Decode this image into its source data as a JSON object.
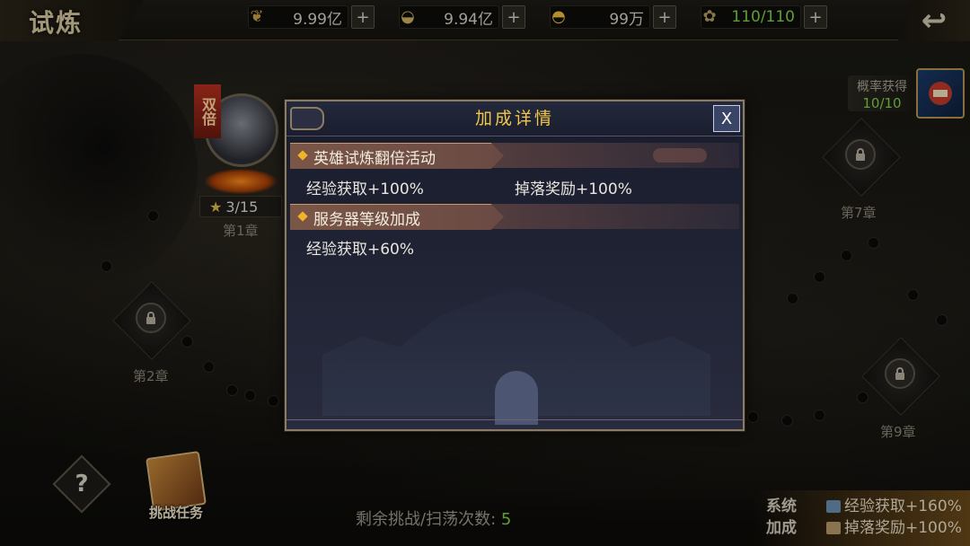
{
  "top": {
    "title": "试炼",
    "resources": [
      {
        "icon": "wheat-icon",
        "value": "9.99亿",
        "plus": "+"
      },
      {
        "icon": "silver-ingot-icon",
        "value": "9.94亿",
        "plus": "+"
      },
      {
        "icon": "gold-ingot-icon",
        "value": "99万",
        "plus": "+"
      },
      {
        "icon": "stamina-icon",
        "value": "110/110",
        "plus": "+"
      }
    ]
  },
  "map": {
    "chapter1": "第1章",
    "chapter2": "第2章",
    "chapter7": "第7章",
    "chapter9": "第9章",
    "hero_tag": "双倍",
    "stars": "3/15",
    "prob_label": "概率获得",
    "prob_count": "10/10"
  },
  "bottom": {
    "help": "?",
    "task_label": "挑战任务",
    "remain_label": "剩余挑战/扫荡次数:",
    "remain_count": "5",
    "sys_label_1": "系统",
    "sys_label_2": "加成",
    "bonus_exp": "经验获取+160%",
    "bonus_drop": "掉落奖励+100%"
  },
  "modal": {
    "title": "加成详情",
    "close": "X",
    "sections": [
      {
        "title": "英雄试炼翻倍活动",
        "items": [
          "经验获取+100%",
          "掉落奖励+100%"
        ]
      },
      {
        "title": "服务器等级加成",
        "items": [
          "经验获取+60%"
        ]
      }
    ]
  },
  "colors": {
    "accent_gold": "#f1c64a",
    "green_value": "#7fd34a"
  }
}
